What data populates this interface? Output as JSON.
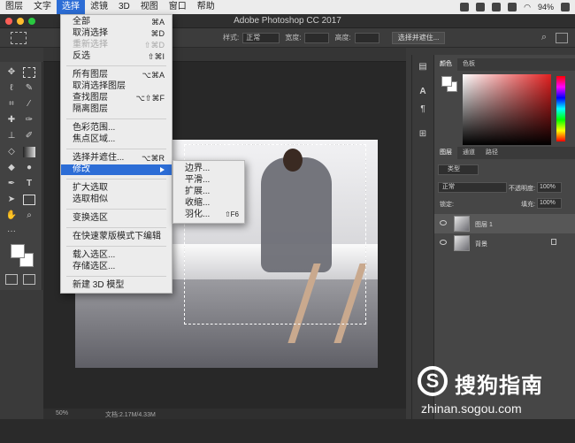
{
  "menubar": {
    "items": [
      "图层",
      "文字",
      "选择",
      "滤镜",
      "3D",
      "视图",
      "窗口",
      "帮助"
    ],
    "active_index": 2,
    "battery": "94%"
  },
  "window": {
    "title": "Adobe Photoshop CC 2017"
  },
  "options_bar": {
    "style_label": "样式:",
    "style_value": "正常",
    "width_label": "宽度:",
    "height_label": "高度:",
    "select_mask_button": "选择并遮住..."
  },
  "status": {
    "zoom": "50%",
    "doc_size": "文档:2.17M/4.33M"
  },
  "select_menu": {
    "items": [
      {
        "label": "全部",
        "shortcut": "⌘A"
      },
      {
        "label": "取消选择",
        "shortcut": "⌘D"
      },
      {
        "label": "重新选择",
        "shortcut": "⇧⌘D"
      },
      {
        "label": "反选",
        "shortcut": "⇧⌘I"
      },
      {
        "label": "所有图层",
        "shortcut": "⌥⌘A"
      },
      {
        "label": "取消选择图层",
        "shortcut": ""
      },
      {
        "label": "查找图层",
        "shortcut": "⌥⇧⌘F"
      },
      {
        "label": "隔离图层",
        "shortcut": ""
      },
      {
        "label": "色彩范围...",
        "shortcut": ""
      },
      {
        "label": "焦点区域...",
        "shortcut": ""
      },
      {
        "label": "选择并遮住...",
        "shortcut": "⌥⌘R"
      },
      {
        "label": "修改",
        "shortcut": ""
      },
      {
        "label": "扩大选取",
        "shortcut": ""
      },
      {
        "label": "选取相似",
        "shortcut": ""
      },
      {
        "label": "变换选区",
        "shortcut": ""
      },
      {
        "label": "在快速蒙版模式下编辑",
        "shortcut": ""
      },
      {
        "label": "载入选区...",
        "shortcut": ""
      },
      {
        "label": "存储选区...",
        "shortcut": ""
      },
      {
        "label": "新建 3D 模型",
        "shortcut": ""
      }
    ]
  },
  "modify_submenu": {
    "items": [
      {
        "label": "边界...",
        "shortcut": ""
      },
      {
        "label": "平滑...",
        "shortcut": ""
      },
      {
        "label": "扩展...",
        "shortcut": ""
      },
      {
        "label": "收缩...",
        "shortcut": ""
      },
      {
        "label": "羽化...",
        "shortcut": "⇧F6"
      }
    ]
  },
  "color_panel": {
    "tabs": [
      "颜色",
      "色板"
    ]
  },
  "layers_panel": {
    "tabs": [
      "图层",
      "通道",
      "路径"
    ],
    "filter_label": "类型",
    "blend_mode": "正常",
    "opacity_label": "不透明度:",
    "opacity_value": "100%",
    "lock_label": "锁定:",
    "fill_label": "填充:",
    "fill_value": "100%",
    "layers": [
      {
        "name": "图层 1"
      },
      {
        "name": "背景"
      }
    ]
  },
  "watermark": {
    "name": "搜狗指南",
    "url": "zhinan.sogou.com"
  },
  "colors": {
    "menu_highlight": "#2c6dd6",
    "menu_bg": "#ececec",
    "panel_bg": "#464646"
  }
}
